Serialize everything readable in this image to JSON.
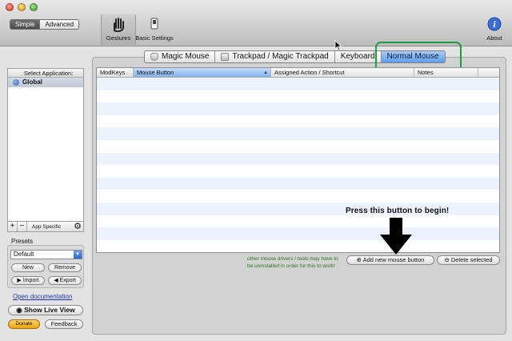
{
  "window": {
    "controls": [
      "close",
      "minimize",
      "zoom"
    ],
    "mode_tabs": {
      "simple": "Simple",
      "advanced": "Advanced",
      "selected": "Simple"
    }
  },
  "toolbar": {
    "gestures": {
      "label": "Gestures",
      "icon": "hand-icon"
    },
    "basic_settings": {
      "label": "Basic Settings",
      "icon": "switch-icon"
    },
    "about": {
      "label": "About",
      "icon": "info-icon"
    }
  },
  "sidebar": {
    "header": "Select Application:",
    "apps": [
      {
        "name": "Global",
        "selected": true
      }
    ],
    "footer": {
      "add": "+",
      "remove": "−",
      "label": "App Specific"
    }
  },
  "presets": {
    "title": "Presets",
    "selected": "Default",
    "new": "New",
    "remove": "Remove",
    "import": "Import",
    "export": "Export"
  },
  "links": {
    "open_documentation": "Open documentation"
  },
  "buttons": {
    "show_live_view": "Show Live View",
    "donate": "Donate",
    "feedback": "Feedback",
    "add_mouse_button": "Add new mouse button",
    "delete_selected": "Delete selected"
  },
  "device_tabs": [
    {
      "label": "Magic Mouse",
      "selected": false
    },
    {
      "label": "Trackpad / Magic Trackpad",
      "selected": false
    },
    {
      "label": "Keyboard",
      "selected": false
    },
    {
      "label": "Normal Mouse",
      "selected": true
    }
  ],
  "table": {
    "columns": [
      "ModKeys",
      "Mouse Button",
      "Assigned Action / Shortcut",
      "Notes"
    ],
    "sorted_column": "Mouse Button",
    "rows": []
  },
  "hint": {
    "press_label": "Press this button to begin!",
    "driver_note": "other mouse drivers / tools may have to be uninstalled in order for this to work!"
  },
  "colors": {
    "tab_selected": "#5d9eee",
    "highlight_ring": "#1f9a45",
    "note_text": "#2a7a1e",
    "link": "#1a33b8"
  }
}
